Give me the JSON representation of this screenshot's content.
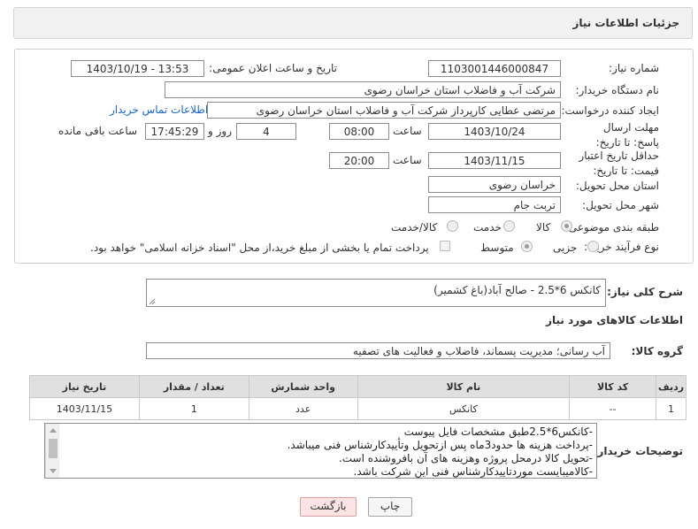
{
  "header": {
    "title": "جزئیات اطلاعات نیاز"
  },
  "form": {
    "need_number_label": "شماره نیاز:",
    "need_number": "1103001446000847",
    "announce_label": "تاریخ و ساعت اعلان عمومی:",
    "announce_value": "1403/10/19 - 13:53",
    "buyer_org_label": "نام دستگاه خریدار:",
    "buyer_org": "شرکت آب و فاضلاب استان خراسان رضوی",
    "creator_label": "ایجاد کننده درخواست:",
    "creator": "مرتضی عطایی کارپرداز شرکت آب و فاضلاب استان خراسان رضوی",
    "contact_link": "اطلاعات تماس خریدار",
    "deadline_label": "مهلت ارسال پاسخ: تا تاریخ:",
    "deadline_date": "1403/10/24",
    "time_label": "ساعت",
    "deadline_time": "08:00",
    "days_value": "4",
    "days_label": "روز و",
    "remaining_time": "17:45:29",
    "remaining_label": "ساعت باقی مانده",
    "validity_label": "حداقل تاریخ اعتبار قیمت: تا تاریخ:",
    "validity_date": "1403/11/15",
    "validity_time": "20:00",
    "province_label": "استان محل تحویل:",
    "province": "خراسان رضوی",
    "city_label": "شهر محل تحویل:",
    "city": "تربت جام",
    "category_label": "طبقه بندی موضوعی:",
    "category_options": [
      "کالا",
      "خدمت",
      "کالا/خدمت"
    ],
    "process_label": "نوع فرآیند خرید :",
    "process_options": [
      "جزیی",
      "متوسط"
    ],
    "payment_note": "پرداخت تمام یا بخشی از مبلغ خرید،از محل \"اسناد خزانه اسلامی\" خواهد بود."
  },
  "description": {
    "label": "شرح کلی نیاز:",
    "value": "کانکس 6*2.5 - صالح آباد(باغ کشمیر)"
  },
  "goods": {
    "section_title": "اطلاعات کالاهای مورد نیاز",
    "group_label": "گروه کالا:",
    "group_value": "آب رسانی؛ مدیریت پسماند، فاضلاب و فعالیت های تصفیه",
    "columns": [
      "ردیف",
      "کد کالا",
      "نام کالا",
      "واحد شمارش",
      "تعداد / مقدار",
      "تاریخ نیاز"
    ],
    "rows": [
      [
        "1",
        "--",
        "کانکس",
        "عدد",
        "1",
        "1403/11/15"
      ]
    ]
  },
  "notes": {
    "label": "توضیحات خریدار:",
    "lines": [
      "-کانکس6*2.5طبق مشخصات فایل پیوست",
      "-پرداخت هزینه ها حدود3ماه پس ازتحویل وتأییدکارشناس فنی میباشد.",
      "-تحویل کالا درمحل پروژه وهزینه های آن بافروشنده است.",
      "-کالامیبایست موردتاییدکارشناس فنی این شرکت باشد."
    ]
  },
  "buttons": {
    "print": "چاپ",
    "back": "بازگشت"
  }
}
